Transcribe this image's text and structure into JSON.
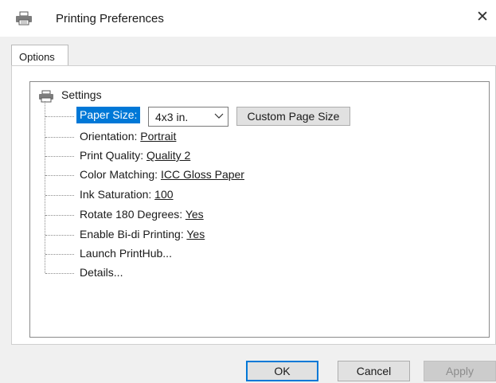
{
  "window": {
    "title": "Printing Preferences",
    "close_glyph": "✕",
    "icon": "printer-icon"
  },
  "tabs": [
    {
      "label": "Options",
      "selected": true
    }
  ],
  "tree": {
    "root": {
      "label": "Settings",
      "icon": "printer-icon"
    },
    "paper_size": {
      "label": "Paper Size:",
      "selected_value": "4x3 in.",
      "custom_button_label": "Custom Page Size"
    },
    "items": [
      {
        "label": "Orientation: ",
        "value": "Portrait"
      },
      {
        "label": "Print Quality: ",
        "value": "Quality 2"
      },
      {
        "label": "Color Matching: ",
        "value": "ICC Gloss Paper"
      },
      {
        "label": "Ink Saturation: ",
        "value": "100"
      },
      {
        "label": "Rotate 180 Degrees: ",
        "value": "Yes"
      },
      {
        "label": "Enable Bi-di Printing: ",
        "value": "Yes"
      },
      {
        "label": "Launch PrintHub...",
        "value": ""
      },
      {
        "label": "Details...",
        "value": ""
      }
    ]
  },
  "buttons": {
    "ok": "OK",
    "cancel": "Cancel",
    "apply": "Apply"
  },
  "colors": {
    "selection": "#0078d7",
    "disabled_text": "#8c8c8c"
  }
}
